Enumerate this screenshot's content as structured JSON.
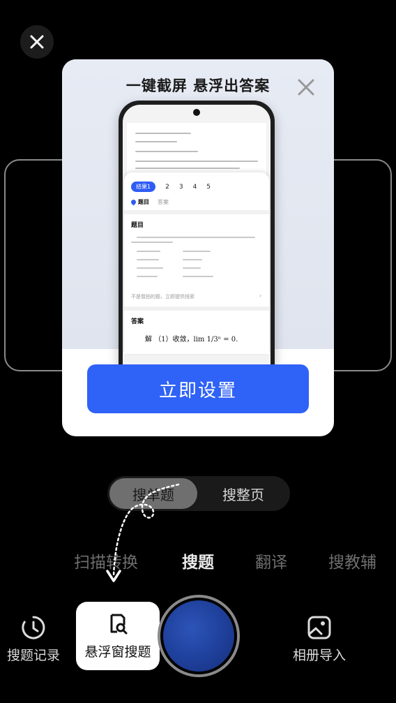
{
  "dialog": {
    "title": "一键截屏 悬浮出答案",
    "cta_label": "立即设置",
    "preview": {
      "result_tabs": [
        "结果1",
        "2",
        "3",
        "4",
        "5"
      ],
      "sub_tabs": {
        "question": "题目",
        "answer": "答案"
      },
      "question_section": "题目",
      "feedback": "不是我拍的题，立即提供线索",
      "answer_section": "答案",
      "answer_text": "解 （1）收敛，lim 1/3ⁿ = 0."
    }
  },
  "mode_switch": {
    "single": "搜单题",
    "page": "搜整页"
  },
  "tool_tabs": [
    "扫描转换",
    "搜题",
    "翻译",
    "搜教辅"
  ],
  "current_tool": "搜题",
  "bottom_bar": {
    "history": "搜题记录",
    "float_search": "悬浮窗搜题",
    "album_import": "相册导入"
  },
  "colors": {
    "accent": "#2f62f6",
    "background": "#000000"
  }
}
